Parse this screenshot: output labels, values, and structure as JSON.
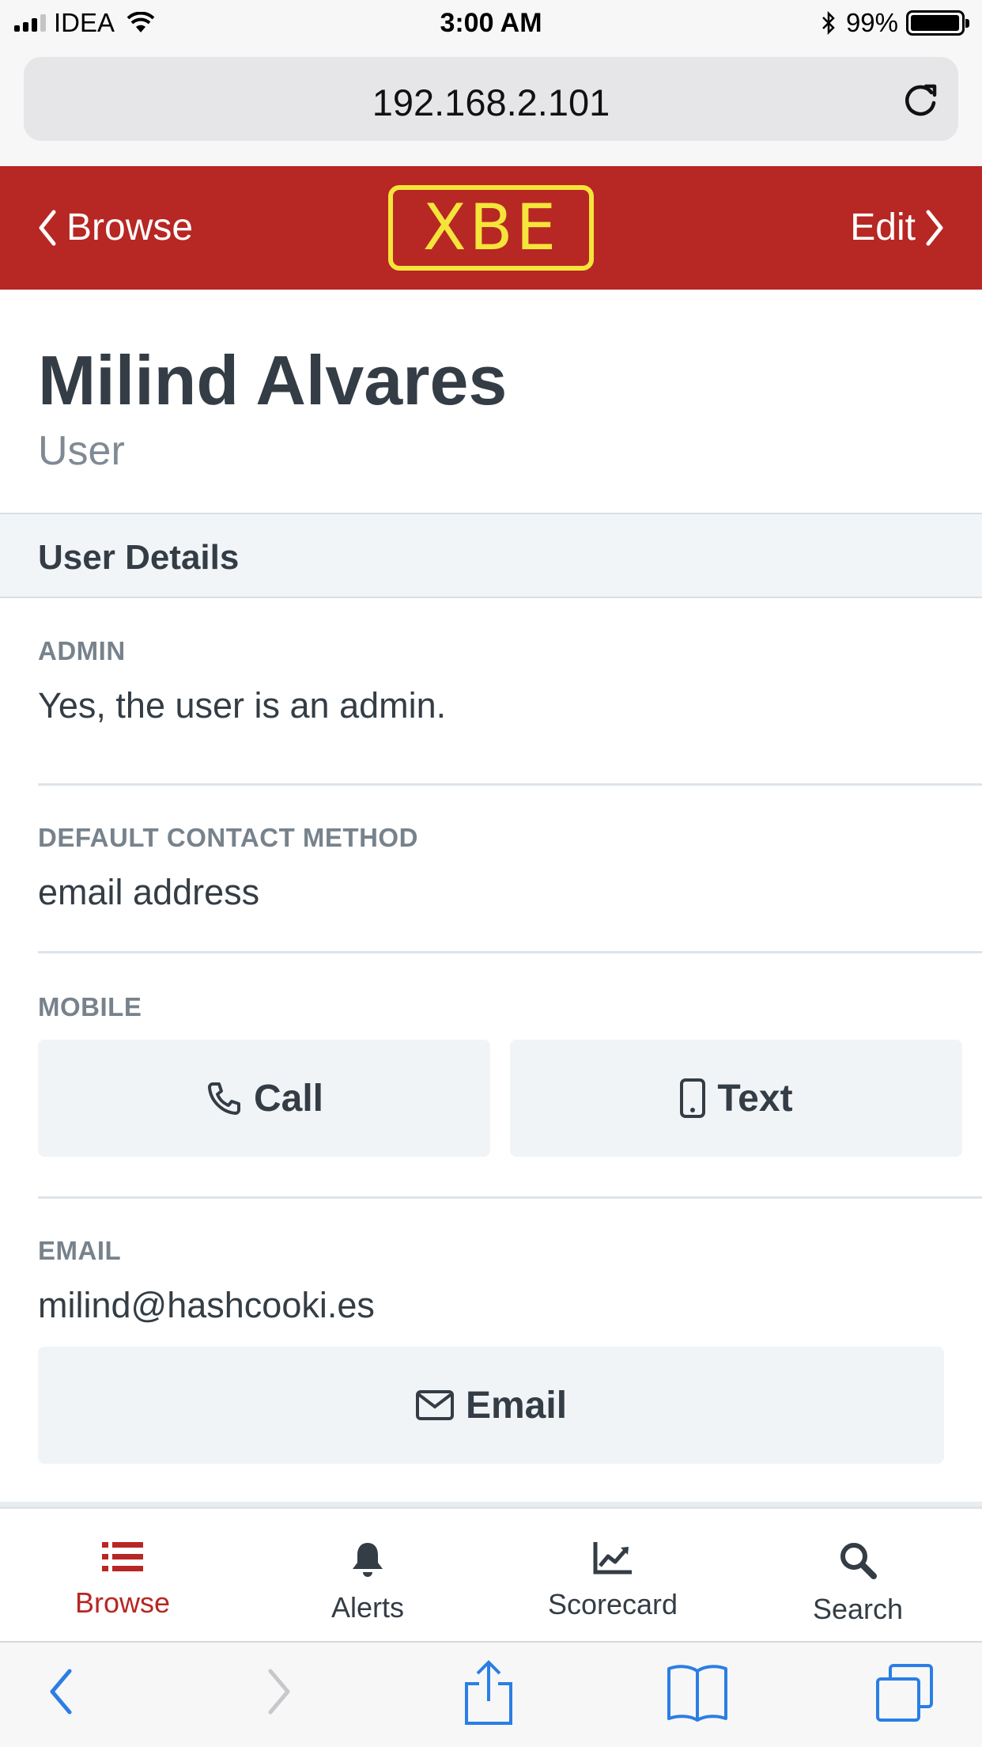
{
  "status_bar": {
    "carrier": "IDEA",
    "time": "3:00 AM",
    "battery": "99%",
    "battery_level": 0.99
  },
  "browser": {
    "url": "192.168.2.101"
  },
  "header": {
    "back_label": "Browse",
    "logo_text": "XBE",
    "edit_label": "Edit",
    "colors": {
      "background": "#b72723",
      "logo": "#f5e43b"
    }
  },
  "profile": {
    "name": "Milind Alvares",
    "role": "User"
  },
  "section": {
    "title": "User Details"
  },
  "fields": {
    "admin": {
      "label": "ADMIN",
      "value": "Yes, the user is an admin."
    },
    "contact_method": {
      "label": "DEFAULT CONTACT METHOD",
      "value": "email address"
    },
    "mobile": {
      "label": "MOBILE",
      "call_label": "Call",
      "text_label": "Text"
    },
    "email": {
      "label": "EMAIL",
      "value": "milind@hashcooki.es",
      "button_label": "Email"
    }
  },
  "bottom_nav": {
    "items": [
      {
        "label": "Browse",
        "icon": "list-icon",
        "active": true
      },
      {
        "label": "Alerts",
        "icon": "bell-icon",
        "active": false
      },
      {
        "label": "Scorecard",
        "icon": "chart-line-icon",
        "active": false
      },
      {
        "label": "Search",
        "icon": "search-icon",
        "active": false
      }
    ],
    "active_color": "#b72723"
  }
}
